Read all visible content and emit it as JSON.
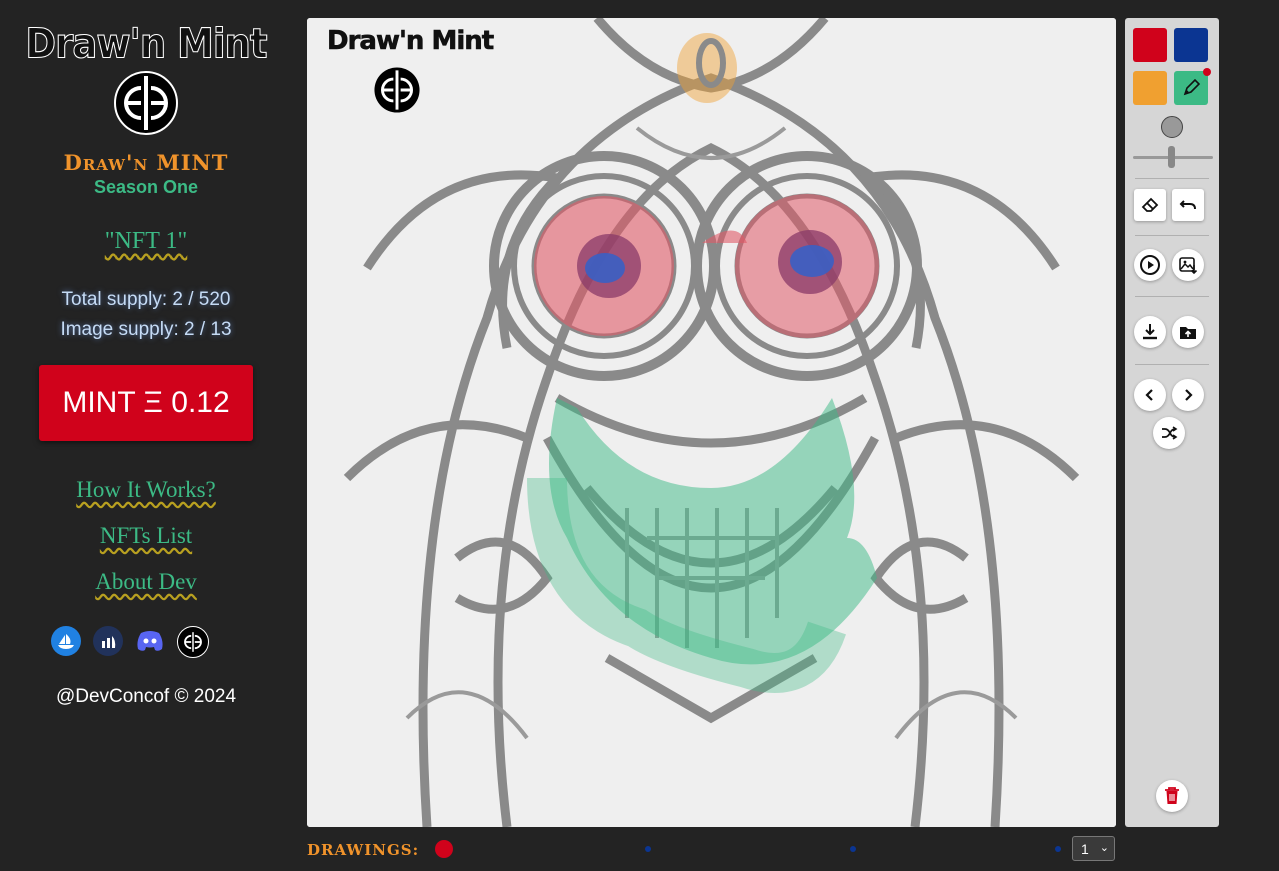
{
  "sidebar": {
    "logo_title": "Draw'n Mint",
    "brand": "Draw'n MINT",
    "season": "Season One",
    "nft_name": "\"NFT 1\"",
    "total_supply": "Total supply: 2 / 520",
    "image_supply": "Image supply: 2 / 13",
    "mint_label": "MINT Ξ 0.12",
    "nav": [
      "How It Works?",
      "NFTs List",
      "About Dev"
    ],
    "socials": [
      "opensea-icon",
      "etherscan-icon",
      "discord-icon",
      "drawnmint-icon"
    ],
    "footer": "@DevConcof © 2024"
  },
  "canvas": {
    "title": "Draw'n Mint"
  },
  "toolbar": {
    "colors": [
      "#d0021b",
      "#0b3592",
      "#f0a030",
      "#3cba85"
    ],
    "active_tool": "pen",
    "icons": [
      "eraser-icon",
      "undo-icon",
      "play-icon",
      "image-download-icon",
      "download-icon",
      "folder-upload-icon",
      "chevron-left-icon",
      "chevron-right-icon",
      "shuffle-icon",
      "trash-icon"
    ]
  },
  "drawings": {
    "label": "DRAWINGS:",
    "selected_page": "1",
    "active_color": "#d0021b",
    "inactive_color": "#0b3592"
  }
}
